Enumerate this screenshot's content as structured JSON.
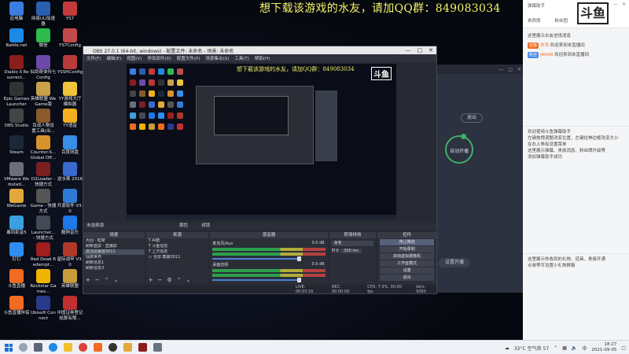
{
  "banner": "想下载该游戏的水友，请加QQ群：849083034",
  "desktop_icons": [
    {
      "label": "此电脑",
      "color": "#3c7de0"
    },
    {
      "label": "网易UU加速器",
      "color": "#2a5fb0"
    },
    {
      "label": "YS7",
      "color": "#c23b3b"
    },
    {
      "label": "Battle.net",
      "color": "#1c89e6"
    },
    {
      "label": "微信",
      "color": "#2dbb4e"
    },
    {
      "label": "YS7Config",
      "color": "#c14a4a"
    },
    {
      "label": "Diablo II Resurrect...",
      "color": "#8b1d1d"
    },
    {
      "label": "仙剑奇侠传七 Config",
      "color": "#6b4aa8"
    },
    {
      "label": "YSSHConfig",
      "color": "#b83a3a"
    },
    {
      "label": "Epic Games Launcher",
      "color": "#333333"
    },
    {
      "label": "英雄联盟 WeGame版",
      "color": "#c9a04a"
    },
    {
      "label": "YY游戏大厅 模拟器",
      "color": "#f0c43a"
    },
    {
      "label": "OBS Studio",
      "color": "#444444"
    },
    {
      "label": "百战人物设 置工具(出...",
      "color": "#8a5a2a"
    },
    {
      "label": "YY语音",
      "color": "#f2b01e"
    },
    {
      "label": "Steam",
      "color": "#1b2838"
    },
    {
      "label": "Counter-S... Global Off...",
      "color": "#d8922a"
    },
    {
      "label": "百度网盘",
      "color": "#3a8ee6"
    },
    {
      "label": "VMware Workstati...",
      "color": "#6b6f7a"
    },
    {
      "label": "D2Loader - 快捷方式",
      "color": "#7a2020"
    },
    {
      "label": "逆水寒 2016",
      "color": "#3a6ad0"
    },
    {
      "label": "WeGame",
      "color": "#e2a83a"
    },
    {
      "label": "Game - 快捷方式",
      "color": "#555555"
    },
    {
      "label": "开源软件 V3.0",
      "color": "#2e7bd6"
    },
    {
      "label": "暴风影音5",
      "color": "#3aa0e0"
    },
    {
      "label": "Launcher... - 快捷方式",
      "color": "#444a55"
    },
    {
      "label": "酷狗音乐",
      "color": "#1e78e8"
    },
    {
      "label": "钉钉",
      "color": "#2e8ef0"
    },
    {
      "label": "Red Dead Redempt...",
      "color": "#a01e1e"
    },
    {
      "label": "星际战甲 V3.0",
      "color": "#b0392a"
    },
    {
      "label": "斗鱼直播",
      "color": "#f26b21"
    },
    {
      "label": "Rockstar Games...",
      "color": "#f0b400"
    },
    {
      "label": "英雄联盟",
      "color": "#c89b3c"
    },
    {
      "label": "斗鱼直播伴侣",
      "color": "#f26b21"
    },
    {
      "label": "Ubisoft Connect",
      "color": "#2a3a8a"
    },
    {
      "label": "中国证券登记 结算有限...",
      "color": "#c03030"
    }
  ],
  "douyu_window": {
    "controls": [
      "—",
      "□",
      "✕"
    ],
    "exit_label": "退出",
    "start_label": "自动开播",
    "pill_label": "设置开播"
  },
  "obs": {
    "title": "OBS 27.0.1 (64-bit, windows) - 配置文件: 未命名 - 场景: 未命名",
    "menu": [
      "文件(F)",
      "编辑(E)",
      "视图(V)",
      "停靠部件(D)",
      "配置文件(P)",
      "场景集合(S)",
      "工具(T)",
      "帮助(H)"
    ],
    "preview_banner": "想下载该游戏的水友，请加QQ群：849083034",
    "preview_logo": "斗鱼",
    "scenebar_label": "未选择源",
    "scenebar_buttons": [
      "属性",
      "滤镜"
    ],
    "docks": {
      "scenes": {
        "header": "场景",
        "items": [
          "大回 · 框架",
          "刷新蓝屏 · 直播屏",
          "激活屏幕窗3011",
          "仙侠世界",
          "刷新信息1",
          "刷新信息3"
        ],
        "selected": 2
      },
      "sources": {
        "header": "来源",
        "items": [
          "AI群",
          "斗鱼信息",
          "上方信息",
          "全屏 截捕3011"
        ]
      },
      "mixer": {
        "header": "混音器",
        "tracks": [
          {
            "label": "麦克风/Aux",
            "level": "0.0 dB"
          },
          {
            "label": "桌面音频",
            "level": "0.0 dB"
          }
        ]
      },
      "transitions": {
        "header": "转场特效",
        "type": "渐变",
        "duration_label": "时长",
        "duration_value": "300 ms"
      },
      "controls": {
        "header": "控件",
        "buttons": [
          "停止推流",
          "开始录制",
          "启动虚拟摄像机",
          "工作室模式",
          "设置",
          "退出"
        ]
      }
    },
    "status": {
      "live": "LIVE: 00:03:16",
      "rec": "REC: 00:00:00",
      "cpu": "CPU: 7.9%, 30.00 fps",
      "kbps": "kb/s: 5093"
    }
  },
  "panel": {
    "title": "弹幕助手",
    "tabs": [
      "贵宾席",
      "粉丝团",
      "礼物"
    ],
    "logo": "斗鱼",
    "welcome_line": "这里展示水友进场消息",
    "messages": [
      {
        "chip": "亚瑟",
        "chip_color": "#f26b21",
        "name": "亦鸿",
        "text": "欢迎来到本直播间"
      },
      {
        "chip": "粉丝",
        "chip_color": "#4a8ce8",
        "name": "JAKAR",
        "text": "欢迎来到本直播间"
      }
    ],
    "help_lines": [
      "欢迎使用斗鱼弹幕助手",
      "左键拖拽调整改变位置，左键拉伸边框改变大小",
      "在右上角有设置菜单",
      "这里展示弹幕、贵族消息、粉丝牌升级等",
      "添加弹幕助手成功"
    ],
    "gift_lines": [
      "这里展示你收到的礼物、道具、贵族开通",
      "点单等可设置小礼物屏蔽"
    ]
  },
  "taskbar": {
    "weather": "32°C 空气良 57",
    "ime": "中",
    "time": "18:27",
    "date": "2021-09-05",
    "icons": [
      "search",
      "task-view",
      "edge",
      "explorer",
      "chrome",
      "douyu",
      "obs",
      "wegame",
      "game",
      "settings"
    ]
  }
}
